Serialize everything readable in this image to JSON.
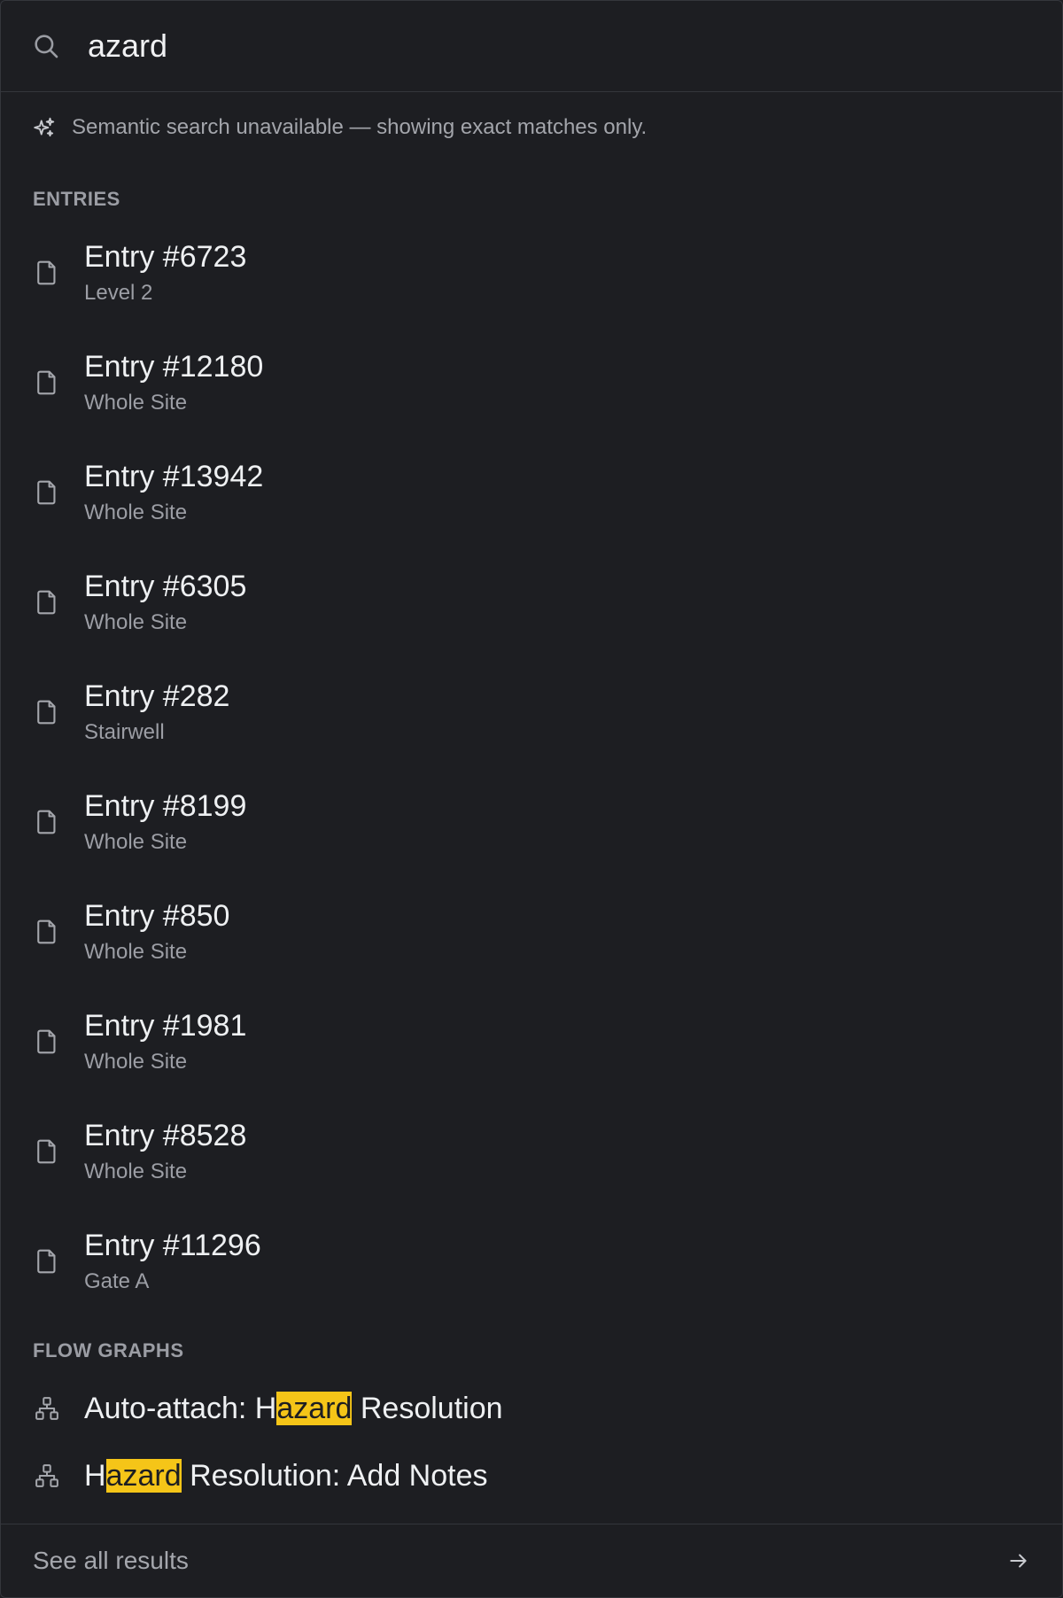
{
  "search": {
    "value": "azard",
    "icon": "search-icon"
  },
  "notice": {
    "icon": "sparkle-icon",
    "text": "Semantic search unavailable — showing exact matches only."
  },
  "entries": {
    "heading": "ENTRIES",
    "icon": "document-icon",
    "items": [
      {
        "title": "Entry #6723",
        "subtitle": "Level 2"
      },
      {
        "title": "Entry #12180",
        "subtitle": "Whole Site"
      },
      {
        "title": "Entry #13942",
        "subtitle": "Whole Site"
      },
      {
        "title": "Entry #6305",
        "subtitle": "Whole Site"
      },
      {
        "title": "Entry #282",
        "subtitle": "Stairwell"
      },
      {
        "title": "Entry #8199",
        "subtitle": "Whole Site"
      },
      {
        "title": "Entry #850",
        "subtitle": "Whole Site"
      },
      {
        "title": "Entry #1981",
        "subtitle": "Whole Site"
      },
      {
        "title": "Entry #8528",
        "subtitle": "Whole Site"
      },
      {
        "title": "Entry #11296",
        "subtitle": "Gate A"
      }
    ]
  },
  "flow_graphs": {
    "heading": "FLOW GRAPHS",
    "icon": "flow-graph-icon",
    "items": [
      {
        "before": "Auto-attach: H",
        "match": "azard",
        "after": " Resolution"
      },
      {
        "before": "H",
        "match": "azard",
        "after": " Resolution: Add Notes"
      }
    ]
  },
  "footer": {
    "label": "See all results",
    "icon": "arrow-right-icon"
  },
  "colors": {
    "background": "#1d1e22",
    "border": "#34363c",
    "highlight": "#f5c518",
    "text_primary": "#eef0f2",
    "text_secondary": "#9c9ea5"
  }
}
